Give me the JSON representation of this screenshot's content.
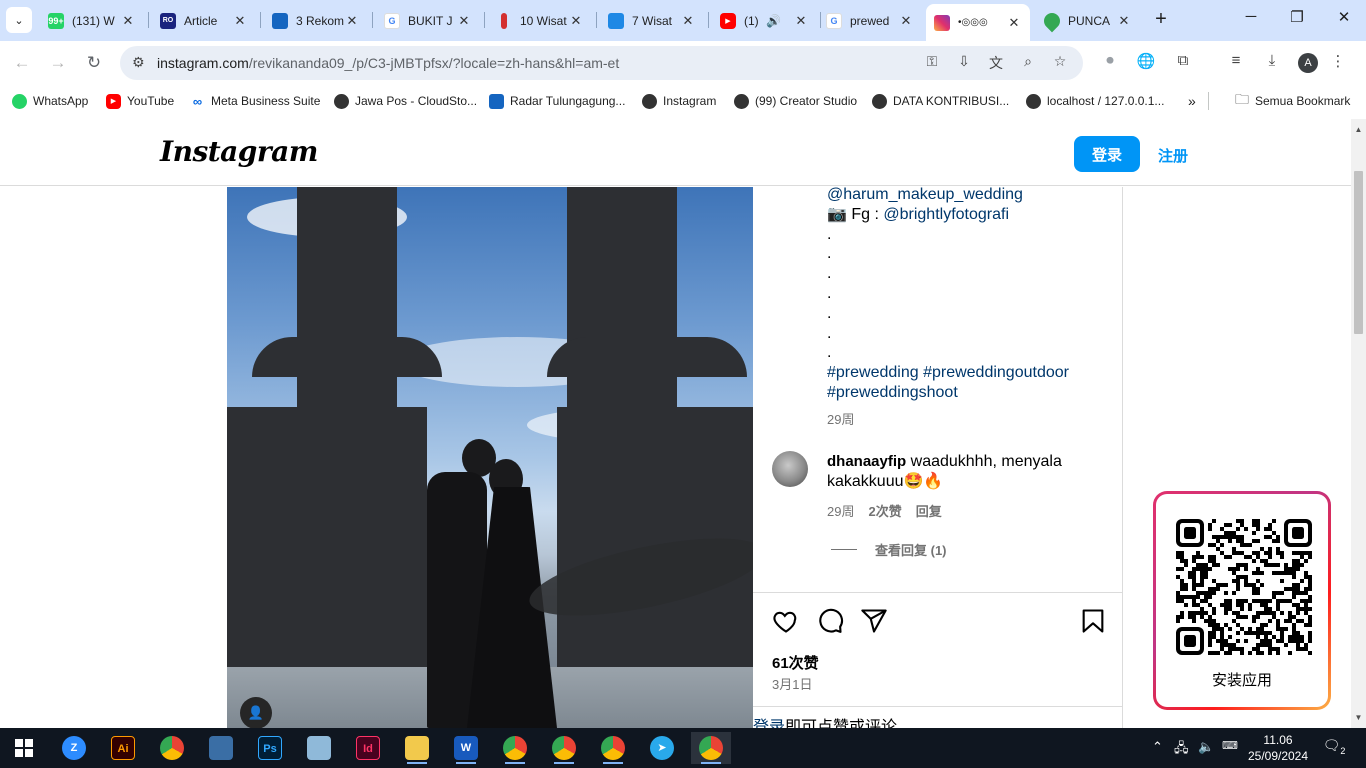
{
  "browser": {
    "tabs": [
      {
        "title": "(131) W",
        "favicon": "whatsapp-icon",
        "badge": "99+"
      },
      {
        "title": "Article",
        "favicon": "article-icon",
        "badge": "RO"
      },
      {
        "title": "3 Rekom",
        "favicon": "radar-icon"
      },
      {
        "title": "BUKIT J",
        "favicon": "google-icon"
      },
      {
        "title": "10 Wisat",
        "favicon": "pin-icon"
      },
      {
        "title": "7 Wisat",
        "favicon": "bird-icon"
      },
      {
        "title": "(1)",
        "favicon": "youtube-icon"
      },
      {
        "title": "prewed",
        "favicon": "google-icon"
      },
      {
        "title": "•◎◎◎",
        "favicon": "instagram-icon"
      },
      {
        "title": "PUNCA",
        "favicon": "maps-icon"
      }
    ],
    "url": {
      "host": "instagram.com",
      "path": "/revikananda09_/p/C3-jMBTpfsx/?locale=zh-hans&hl=am-et"
    },
    "profile_initial": "A",
    "bookmarks": [
      {
        "label": "WhatsApp",
        "icon": "whatsapp-icon"
      },
      {
        "label": "YouTube",
        "icon": "youtube-icon"
      },
      {
        "label": "Meta Business Suite",
        "icon": "meta-icon"
      },
      {
        "label": "Jawa Pos - CloudSto...",
        "icon": "globe-icon"
      },
      {
        "label": "Radar Tulungagung...",
        "icon": "radar-icon"
      },
      {
        "label": "Instagram",
        "icon": "globe-icon"
      },
      {
        "label": "(99) Creator Studio",
        "icon": "globe-icon"
      },
      {
        "label": "DATA KONTRIBUSI...",
        "icon": "globe-icon"
      },
      {
        "label": "localhost / 127.0.0.1...",
        "icon": "globe-icon"
      }
    ],
    "bookmarks_folder": "Semua Bookmark",
    "overflow": "»"
  },
  "instagram": {
    "logo": "Instagram",
    "login_label": "登录",
    "signup_label": "注册",
    "caption": {
      "line1": "@harum_makeup_wedding",
      "line2_prefix": "📷 Fg : ",
      "line2_link": "@brightlyfotografi",
      "dots": [
        ".",
        ".",
        ".",
        ".",
        ".",
        ".",
        "."
      ],
      "tags_line1": "#prewedding #preweddingoutdoor",
      "tags_line2": "#preweddingshoot"
    },
    "caption_time": "29周",
    "comment": {
      "user": "dhanaayfip",
      "text": " waadukhhh, menyala kakakkuuu🤩🔥",
      "time": "29周",
      "likes": "2次赞",
      "reply": "回复",
      "view_replies": "查看回复 (1)"
    },
    "likes": "61次赞",
    "date": "3月1日",
    "login_prompt_link": "登录",
    "login_prompt_rest": "即可点赞或评论",
    "install_app": "安装应用"
  },
  "taskbar": {
    "apps": [
      "zoom",
      "illustrator",
      "chrome",
      "network",
      "photoshop",
      "files",
      "indesign",
      "explorer",
      "word",
      "chrome-profile-1",
      "chrome-profile-2",
      "chrome-profile-3",
      "telegram",
      "chrome-active"
    ],
    "time": "11.06",
    "date": "25/09/2024",
    "notifications": "2"
  }
}
